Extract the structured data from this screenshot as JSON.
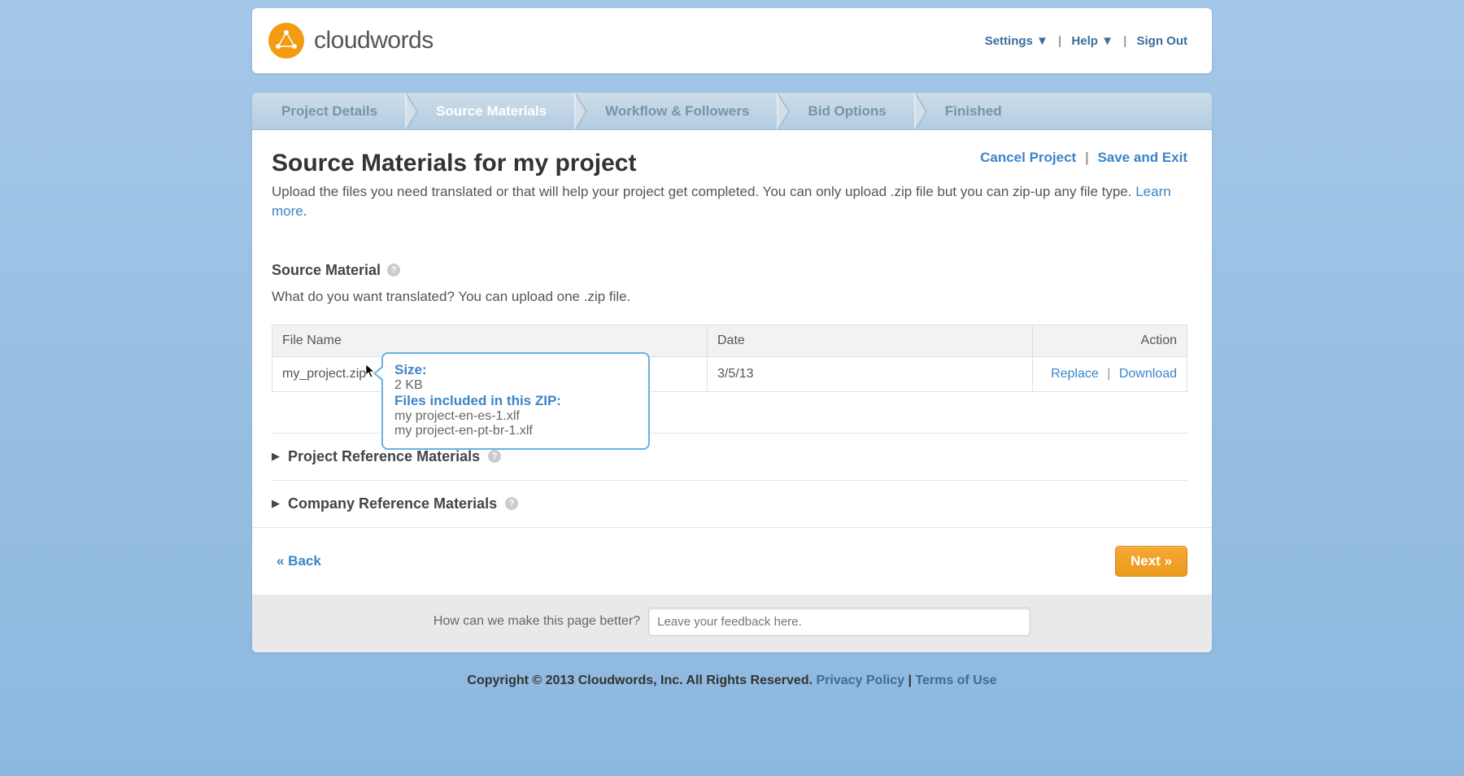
{
  "brand": "cloudwords",
  "topnav": {
    "settings": "Settings ▼",
    "help": "Help ▼",
    "signout": "Sign Out"
  },
  "stepper": {
    "items": [
      {
        "label": "Project Details"
      },
      {
        "label": "Source Materials"
      },
      {
        "label": "Workflow & Followers"
      },
      {
        "label": "Bid Options"
      },
      {
        "label": "Finished"
      }
    ]
  },
  "title": "Source Materials for my project",
  "title_actions": {
    "cancel": "Cancel Project",
    "save": "Save and Exit"
  },
  "subtitle_pre": "Upload the files you need translated or that will help your project get completed. You can only upload .zip file but you can zip-up any file type. ",
  "subtitle_link": "Learn more",
  "section": {
    "source_material": "Source Material",
    "source_desc": "What do you want translated? You can upload one .zip file."
  },
  "table": {
    "col_filename": "File Name",
    "col_date": "Date",
    "col_action": "Action",
    "row": {
      "filename": "my_project.zip",
      "date": "3/5/13",
      "replace": "Replace",
      "download": "Download"
    }
  },
  "tooltip": {
    "size_label": "Size:",
    "size_val": "2 KB",
    "files_label": "Files included in this ZIP:",
    "file1": "my project-en-es-1.xlf",
    "file2": "my project-en-pt-br-1.xlf"
  },
  "collapsible": {
    "project_ref": "Project Reference Materials",
    "company_ref": "Company Reference Materials"
  },
  "back": "« Back",
  "next": "Next »",
  "feedback": {
    "label": "How can we make this page better?",
    "placeholder": "Leave your feedback here."
  },
  "footer": {
    "copyright": "Copyright © 2013 Cloudwords, Inc. All Rights Reserved. ",
    "privacy": "Privacy Policy",
    "terms": "Terms of Use"
  }
}
